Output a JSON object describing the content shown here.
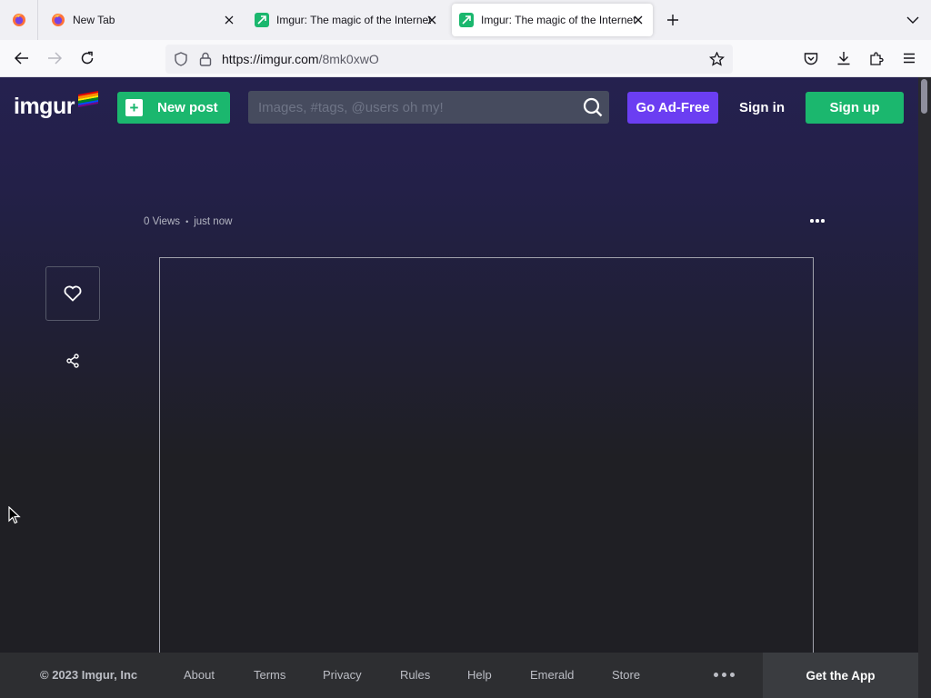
{
  "browser": {
    "tabs": [
      {
        "title": "New Tab",
        "active": false
      },
      {
        "title": "Imgur: The magic of the Internet",
        "active": false
      },
      {
        "title": "Imgur: The magic of the Internet",
        "active": true
      }
    ],
    "url_host": "https://imgur.com",
    "url_path": "/8mk0xwO"
  },
  "header": {
    "logo_text": "imgur",
    "new_post_label": "New post",
    "search_placeholder": "Images, #tags, @users oh my!",
    "go_ad_free_label": "Go Ad-Free",
    "sign_in_label": "Sign in",
    "sign_up_label": "Sign up"
  },
  "post": {
    "views": "0 Views",
    "separator": "•",
    "time": "just now"
  },
  "footer": {
    "copyright": "© 2023 Imgur, Inc",
    "links": [
      "About",
      "Terms",
      "Privacy",
      "Rules",
      "Help",
      "Emerald",
      "Store"
    ],
    "get_app_label": "Get the App"
  },
  "colors": {
    "brand_green": "#1bb76e",
    "ad_free_purple": "#6b3ef2",
    "page_bg_top": "#25214f",
    "page_bg_bottom": "#1f1f24",
    "footer_bg": "#2d2e31"
  },
  "icons": [
    "firefox-icon",
    "imgur-favicon",
    "close-icon",
    "plus-icon",
    "chevron-down-icon",
    "back-arrow-icon",
    "forward-arrow-icon",
    "reload-icon",
    "shield-icon",
    "lock-icon",
    "star-icon",
    "pocket-icon",
    "download-icon",
    "extensions-icon",
    "menu-icon",
    "search-icon",
    "heart-icon",
    "share-icon",
    "more-icon"
  ]
}
